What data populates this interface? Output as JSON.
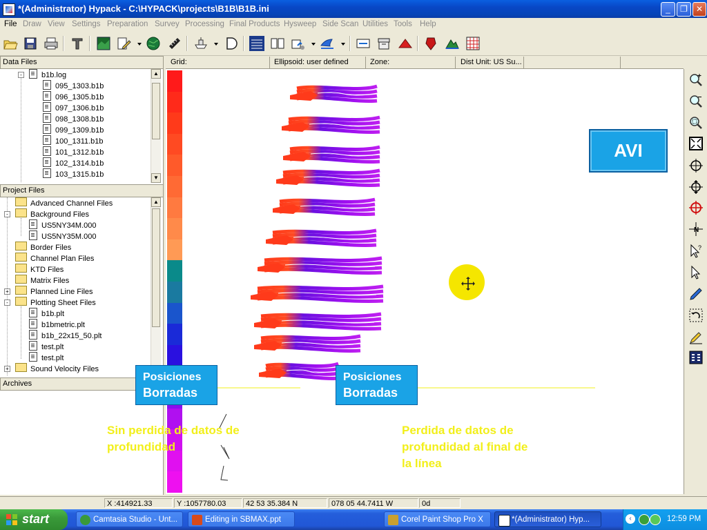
{
  "window": {
    "title": "*(Administrator) Hypack - C:\\HYPACK\\projects\\B1B\\B1B.ini",
    "controls": {
      "minimize": "_",
      "restore": "❐",
      "close": "✕"
    }
  },
  "menu": [
    {
      "label": "File",
      "enabled": true
    },
    {
      "label": "Draw",
      "enabled": false
    },
    {
      "label": "View",
      "enabled": false
    },
    {
      "label": "Settings",
      "enabled": false
    },
    {
      "label": "Preparation",
      "enabled": false
    },
    {
      "label": "Survey",
      "enabled": false
    },
    {
      "label": "Processing",
      "enabled": false
    },
    {
      "label": "Final Products",
      "enabled": false
    },
    {
      "label": "Hysweep",
      "enabled": false
    },
    {
      "label": "Side Scan",
      "enabled": false
    },
    {
      "label": "Utilities",
      "enabled": false
    },
    {
      "label": "Tools",
      "enabled": false
    },
    {
      "label": "Help",
      "enabled": false
    }
  ],
  "toolbar_icons": [
    "open-folder-icon",
    "save-icon",
    "print-icon",
    "tools-icon",
    "map-icon",
    "edit-icon",
    "globe-icon",
    "ruler-icon",
    "vessel-icon",
    "d-icon",
    "grid-icon",
    "book-icon",
    "calendar-icon",
    "boat-icon",
    "monitor-icon",
    "archive-icon",
    "triangle-icon",
    "shield-icon",
    "terrain-icon",
    "matrix-icon"
  ],
  "data_files": {
    "header": "Data Files",
    "root": "b1b.log",
    "items": [
      "095_1303.b1b",
      "096_1305.b1b",
      "097_1306.b1b",
      "098_1308.b1b",
      "099_1309.b1b",
      "100_1311.b1b",
      "101_1312.b1b",
      "102_1314.b1b",
      "103_1315.b1b"
    ]
  },
  "project_files": {
    "header": "Project Files",
    "items": [
      {
        "label": "Advanced Channel Files",
        "type": "folder",
        "level": 0,
        "expander": ""
      },
      {
        "label": "Background Files",
        "type": "folder",
        "level": 0,
        "expander": "-"
      },
      {
        "label": "US5NY34M.000",
        "type": "file",
        "level": 1,
        "expander": ""
      },
      {
        "label": "US5NY35M.000",
        "type": "file",
        "level": 1,
        "expander": ""
      },
      {
        "label": "Border Files",
        "type": "folder",
        "level": 0,
        "expander": ""
      },
      {
        "label": "Channel Plan Files",
        "type": "folder",
        "level": 0,
        "expander": ""
      },
      {
        "label": "KTD Files",
        "type": "folder",
        "level": 0,
        "expander": ""
      },
      {
        "label": "Matrix Files",
        "type": "folder",
        "level": 0,
        "expander": ""
      },
      {
        "label": "Planned Line Files",
        "type": "folder",
        "level": 0,
        "expander": "+"
      },
      {
        "label": "Plotting Sheet Files",
        "type": "folder",
        "level": 0,
        "expander": "-"
      },
      {
        "label": "b1b.plt",
        "type": "file",
        "level": 1,
        "expander": ""
      },
      {
        "label": "b1bmetric.plt",
        "type": "file",
        "level": 1,
        "expander": ""
      },
      {
        "label": "b1b_22x15_50.plt",
        "type": "file",
        "level": 1,
        "expander": ""
      },
      {
        "label": "test.plt",
        "type": "file",
        "level": 1,
        "expander": ""
      },
      {
        "label": "test.plt",
        "type": "file",
        "level": 1,
        "expander": ""
      },
      {
        "label": "Sound Velocity Files",
        "type": "folder",
        "level": 0,
        "expander": "+"
      }
    ]
  },
  "archives": {
    "header": "Archives"
  },
  "map_header": {
    "grid": "Grid:",
    "ellipsoid": "Ellipsoid: user defined",
    "zone": "Zone:",
    "dist_unit": "Dist Unit: US Su..."
  },
  "colorbar_colors": [
    "#ff1a1a",
    "#ff2a1a",
    "#ff3a1a",
    "#ff4a22",
    "#ff5a2a",
    "#ff6a34",
    "#ff7a40",
    "#ff8a4a",
    "#ff9a55",
    "#0a8a8a",
    "#1a7aa0",
    "#1a55cc",
    "#1a2ad8",
    "#2a10e0",
    "#5a10e8",
    "#8a10ee",
    "#b010f0",
    "#d010f0",
    "#e010f0",
    "#ee10f0"
  ],
  "overlay": {
    "avi_label": "AVI",
    "callout_left": {
      "line1": "Posiciones",
      "line2": "Borradas"
    },
    "callout_right": {
      "line1": "Posiciones",
      "line2": "Borradas"
    },
    "note_left": {
      "line1": "Sin perdida de datos de",
      "line2": "profundidad"
    },
    "note_right": {
      "line1": "Perdida de datos de",
      "line2": "profundidad al final de",
      "line3": "la línea"
    }
  },
  "right_tools": [
    "zoom-in-icon",
    "zoom-out-icon",
    "zoom-box-icon",
    "zoom-extents-icon",
    "pan-center-icon",
    "pan-icon",
    "target-icon",
    "north-icon",
    "query-pointer-icon",
    "pointer-icon",
    "pen-probe-icon",
    "undo-icon",
    "pencil-icon",
    "calculator-icon"
  ],
  "status": {
    "x": "X :414921.33",
    "y": "Y :1057780.03",
    "lat": "42 53 35.384 N",
    "lon": "078 05 44.7411 W",
    "heading": "0d"
  },
  "taskbar": {
    "start": "start",
    "tasks": [
      {
        "label": "Camtasia Studio - Unt...",
        "active": false
      },
      {
        "label": "Editing in SBMAX.ppt",
        "active": false
      },
      {
        "label": "Corel Paint Shop Pro X",
        "active": false
      },
      {
        "label": "*(Administrator) Hyp...",
        "active": true
      }
    ],
    "clock": "12:59 PM"
  },
  "colors": {
    "callout_blue": "#1aa3e6",
    "note_yellow": "#f2ef1a",
    "cursor_circle": "#f5e600",
    "xp_blue": "#0a5fe0"
  }
}
